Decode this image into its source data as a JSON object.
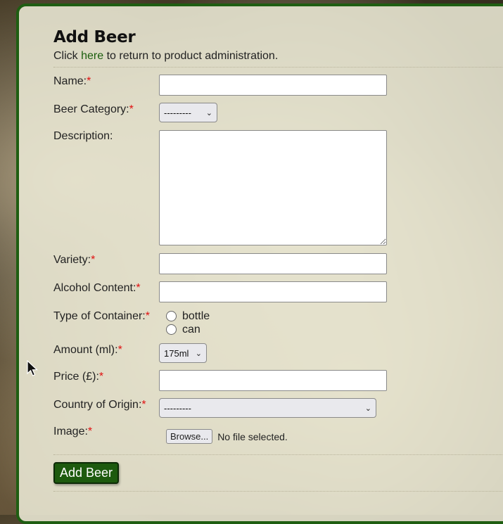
{
  "page": {
    "title": "Add Beer",
    "intro_before": "Click ",
    "intro_link": "here",
    "intro_after": " to return to product administration."
  },
  "form": {
    "required_mark": "*",
    "name_label": "Name:",
    "category_label": "Beer Category:",
    "category_value": "---------",
    "description_label": "Description:",
    "variety_label": "Variety:",
    "alcohol_label": "Alcohol Content:",
    "container_label": "Type of Container:",
    "container_options": [
      "bottle",
      "can"
    ],
    "amount_label": "Amount (ml):",
    "amount_value": "175ml",
    "price_label": "Price (£):",
    "country_label": "Country of Origin:",
    "country_value": "---------",
    "image_label": "Image:",
    "browse_label": "Browse...",
    "file_status": "No file selected.",
    "submit_label": "Add Beer"
  },
  "colors": {
    "accent": "#1d5a0e",
    "border": "#1f5e12",
    "required": "#e01010",
    "link": "#1b5e0d"
  }
}
